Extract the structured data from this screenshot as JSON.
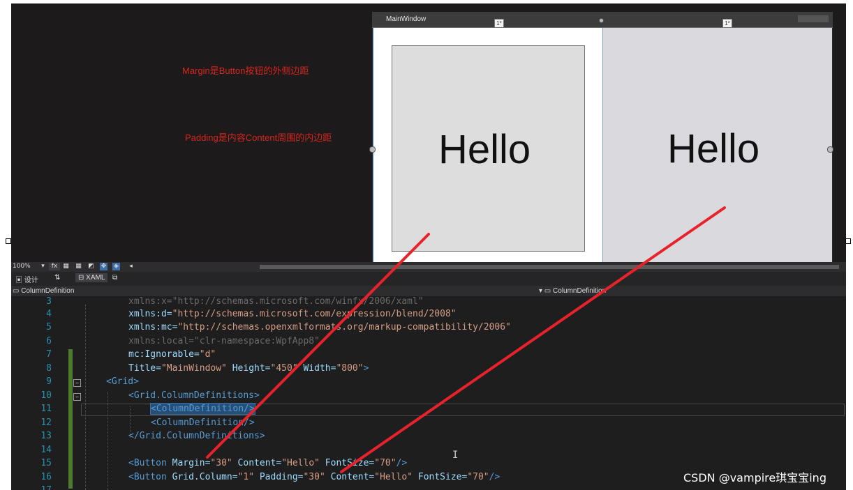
{
  "designer": {
    "note_margin": "Margin是Button按钮的外侧边距",
    "note_padding": "Padding是内容Content周围的内边距",
    "window_title": "MainWindow",
    "col_marker_1": "1*",
    "col_marker_2": "1*",
    "button1_content": "Hello",
    "button2_content": "Hello"
  },
  "toolbar": {
    "zoom": "100%",
    "fx": "fx"
  },
  "tabs": {
    "design": "设计",
    "swap": "⇅",
    "xaml": "XAML"
  },
  "navbar": {
    "left": "ColumnDefinition",
    "right": "ColumnDefinition"
  },
  "code_lines": [
    {
      "n": "3",
      "text": "xmlns:x=\"http://schemas.microsoft.com/winfx/2006/xaml\""
    },
    {
      "n": "4",
      "prefix": "xmlns:d=",
      "value": "\"http://schemas.microsoft.com/expression/blend/2008\""
    },
    {
      "n": "5",
      "prefix": "xmlns:mc=",
      "value": "\"http://schemas.openxmlformats.org/markup-compatibility/2006\""
    },
    {
      "n": "6",
      "prefix": "xmlns:local=",
      "value": "\"clr-namespace:WpfApp8\""
    },
    {
      "n": "7",
      "prefix": "mc:Ignorable=",
      "value": "\"d\""
    },
    {
      "n": "8",
      "a1": "Title=",
      "v1": "\"MainWindow\"",
      "a2": " Height=",
      "v2": "\"450\"",
      "a3": " Width=",
      "v3": "\"800\"",
      "end": ">"
    },
    {
      "n": "9",
      "tag": "<Grid>"
    },
    {
      "n": "10",
      "tag": "<Grid.ColumnDefinitions>"
    },
    {
      "n": "11",
      "tag": "<ColumnDefinition/>"
    },
    {
      "n": "12",
      "tag": "<ColumnDefinition/>"
    },
    {
      "n": "13",
      "tag": "</Grid.ColumnDefinitions>"
    },
    {
      "n": "14"
    },
    {
      "n": "15",
      "t": "<Button",
      "a1": " Margin=",
      "v1": "\"30\"",
      "a2": " Content=",
      "v2": "\"Hello\"",
      "a3": " FontSize=",
      "v3": "\"70\"",
      "end": "/>"
    },
    {
      "n": "16",
      "t": "<Button",
      "a1": " Grid.Column=",
      "v1": "\"1\"",
      "a2": " Padding=",
      "v2": "\"30\"",
      "a3": " Content=",
      "v3": "\"Hello\"",
      "a4": " FontSize=",
      "v4": "\"70\"",
      "end": "/>"
    },
    {
      "n": "17"
    }
  ],
  "watermark": "CSDN @vampire琪宝宝ing",
  "colors": {
    "annotation_red": "#e8222b",
    "editor_bg": "#1e1e1e",
    "selection": "#264f78"
  }
}
